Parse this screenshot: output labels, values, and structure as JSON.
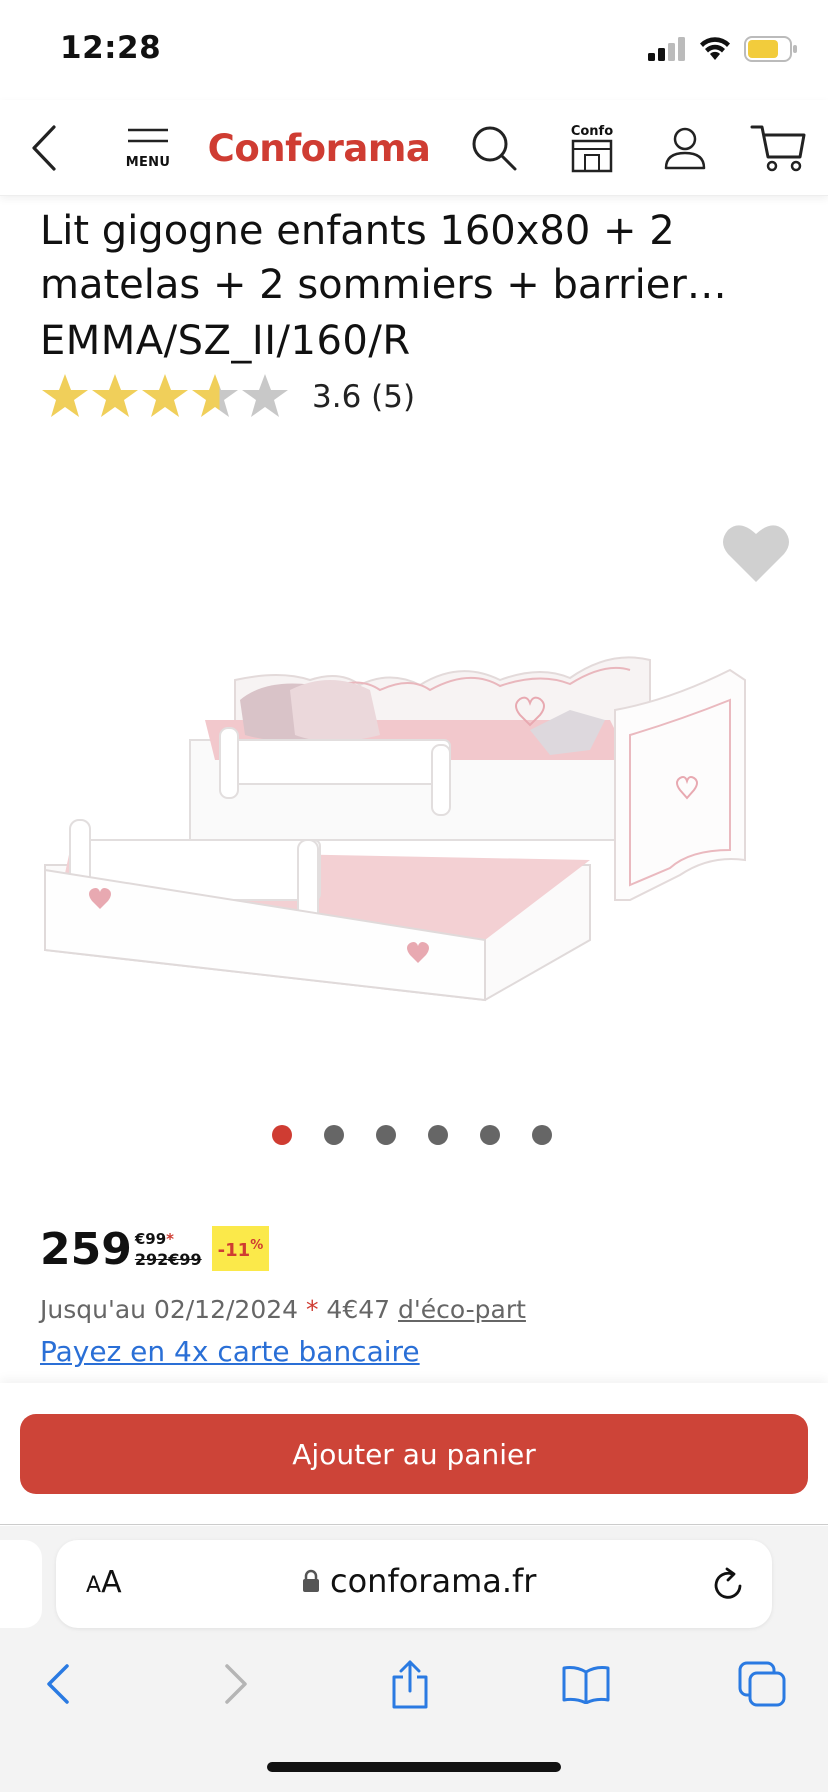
{
  "status": {
    "time": "12:28"
  },
  "header": {
    "menu_label": "MENU",
    "logo": "Conforama",
    "confo_label": "Confo"
  },
  "product": {
    "title_line1": "Lit gigogne enfants 160x80 + 2",
    "title_line2": "matelas + 2 sommiers + barrier…",
    "reference": "EMMA/SZ_II/160/R",
    "rating_value": 3.6,
    "rating_text": "3.6 (5)",
    "image_count": 6,
    "active_image": 1
  },
  "price": {
    "integer": "259",
    "cents": "€99",
    "asterisk": "*",
    "old_price": "292€99",
    "discount": "-11",
    "discount_sup": "%",
    "eco_text_prefix": "Jusqu'au 02/12/2024 ",
    "eco_star": "*",
    "eco_amount": " 4€47 ",
    "eco_link": "d'éco-part",
    "pay_link": "Payez en 4x carte bancaire"
  },
  "cart": {
    "button_label": "Ajouter au panier"
  },
  "safari": {
    "aa_small": "A",
    "aa_big": "A",
    "url": "conforama.fr"
  },
  "colors": {
    "brand": "#cf3c32",
    "button": "#cd4438",
    "discount_bg": "#fbe94a",
    "link": "#2a6fd6",
    "star": "#f0cf5a"
  }
}
